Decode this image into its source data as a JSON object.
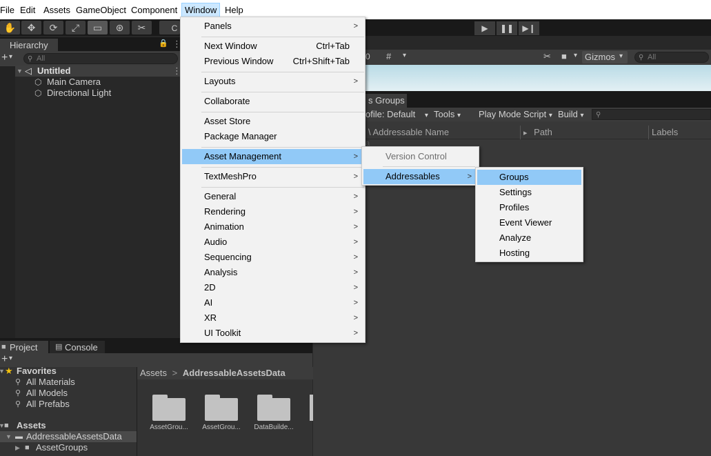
{
  "menubar": {
    "items": [
      {
        "label": "File"
      },
      {
        "label": "Edit"
      },
      {
        "label": "Assets"
      },
      {
        "label": "GameObject"
      },
      {
        "label": "Component"
      },
      {
        "label": "Window"
      },
      {
        "label": "Help"
      }
    ]
  },
  "toolbar": {
    "tool_icons": [
      "hand-icon",
      "move-icon",
      "rotate-icon",
      "scale-icon",
      "rect-icon",
      "transform-icon",
      "custom-tool-icon"
    ],
    "partial_label": "C",
    "play_icons": [
      "play-icon",
      "pause-icon",
      "step-icon"
    ]
  },
  "hierarchy": {
    "tab_label": "Hierarchy",
    "add_label": "+",
    "search_placeholder": "All",
    "scene_name": "Untitled",
    "objects": [
      "Main Camera",
      "Directional Light"
    ]
  },
  "scene_bar": {
    "layers_count": "0",
    "gizmos_label": "Gizmos",
    "search_placeholder": "All"
  },
  "groups_window": {
    "tab_label": "s Groups",
    "profile_label": "ofile: Default",
    "tools_label": "Tools",
    "play_mode_label": "Play Mode Script",
    "build_label": "Build",
    "col_name": "\\ Addressable Name",
    "col_path": "Path",
    "col_labels": "Labels",
    "faint_text": "a"
  },
  "project": {
    "tabs": [
      {
        "label": "Project"
      },
      {
        "label": "Console"
      }
    ],
    "add_label": "+",
    "favorites_label": "Favorites",
    "favorites": [
      "All Materials",
      "All Models",
      "All Prefabs"
    ],
    "assets_label": "Assets",
    "tree": [
      "AddressableAssetsData",
      "AssetGroups"
    ],
    "breadcrumb_root": "Assets",
    "breadcrumb_sep": ">",
    "breadcrumb_current": "AddressableAssetsData",
    "files": [
      "AssetGrou...",
      "AssetGrou...",
      "DataBuilde..."
    ]
  },
  "window_menu": {
    "items": [
      {
        "label": "Panels",
        "shortcut": "",
        "submenu": true
      },
      {
        "label": "Next Window",
        "shortcut": "Ctrl+Tab",
        "submenu": false
      },
      {
        "label": "Previous Window",
        "shortcut": "Ctrl+Shift+Tab",
        "submenu": false
      },
      {
        "label": "Layouts",
        "shortcut": "",
        "submenu": true
      },
      {
        "label": "Collaborate",
        "shortcut": "",
        "submenu": false
      },
      {
        "label": "Asset Store",
        "shortcut": "",
        "submenu": false
      },
      {
        "label": "Package Manager",
        "shortcut": "",
        "submenu": false
      },
      {
        "label": "Asset Management",
        "shortcut": "",
        "submenu": true
      },
      {
        "label": "TextMeshPro",
        "shortcut": "",
        "submenu": true
      },
      {
        "label": "General",
        "shortcut": "",
        "submenu": true
      },
      {
        "label": "Rendering",
        "shortcut": "",
        "submenu": true
      },
      {
        "label": "Animation",
        "shortcut": "",
        "submenu": true
      },
      {
        "label": "Audio",
        "shortcut": "",
        "submenu": true
      },
      {
        "label": "Sequencing",
        "shortcut": "",
        "submenu": true
      },
      {
        "label": "Analysis",
        "shortcut": "",
        "submenu": true
      },
      {
        "label": "2D",
        "shortcut": "",
        "submenu": true
      },
      {
        "label": "AI",
        "shortcut": "",
        "submenu": true
      },
      {
        "label": "XR",
        "shortcut": "",
        "submenu": true
      },
      {
        "label": "UI Toolkit",
        "shortcut": "",
        "submenu": true
      }
    ]
  },
  "asset_management_menu": {
    "items": [
      {
        "label": "Version Control",
        "disabled": true
      },
      {
        "label": "Addressables",
        "submenu": true
      }
    ]
  },
  "addressables_menu": {
    "items": [
      {
        "label": "Groups"
      },
      {
        "label": "Settings"
      },
      {
        "label": "Profiles"
      },
      {
        "label": "Event Viewer"
      },
      {
        "label": "Analyze"
      },
      {
        "label": "Hosting"
      }
    ]
  },
  "glyphs": {
    "submenu_arrow": ">",
    "dropdown": "▾",
    "kebab": "⋮",
    "lock": "🔒",
    "search": "⚲",
    "star": "★"
  },
  "colors": {
    "menu_highlight": "#91c9f7",
    "menu_bg": "#f2f2f2",
    "editor_dark": "#282828",
    "panel_mid": "#3c3c3c",
    "star": "#f4c20d"
  }
}
